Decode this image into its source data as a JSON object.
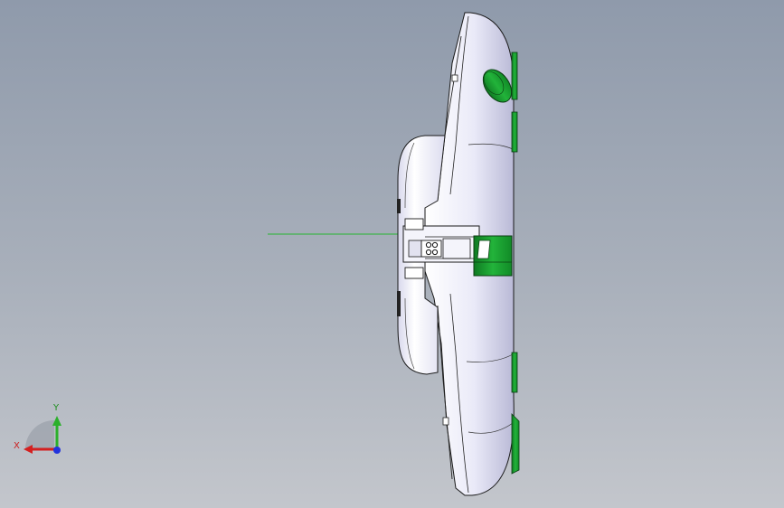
{
  "viewport": {
    "background_top": "#8f9aab",
    "background_bottom": "#c3c6cc"
  },
  "model": {
    "body_color": "#e6e6f6",
    "accent_color": "#19a233",
    "edge_color": "#1a1a1a",
    "sketch_line_color": "#25b52f"
  },
  "triad": {
    "x_label": "X",
    "y_label": "Y",
    "x_color": "#d42020",
    "y_color": "#2bb02b",
    "z_color": "#2233dd",
    "icon": "coordinate-triad-icon"
  }
}
